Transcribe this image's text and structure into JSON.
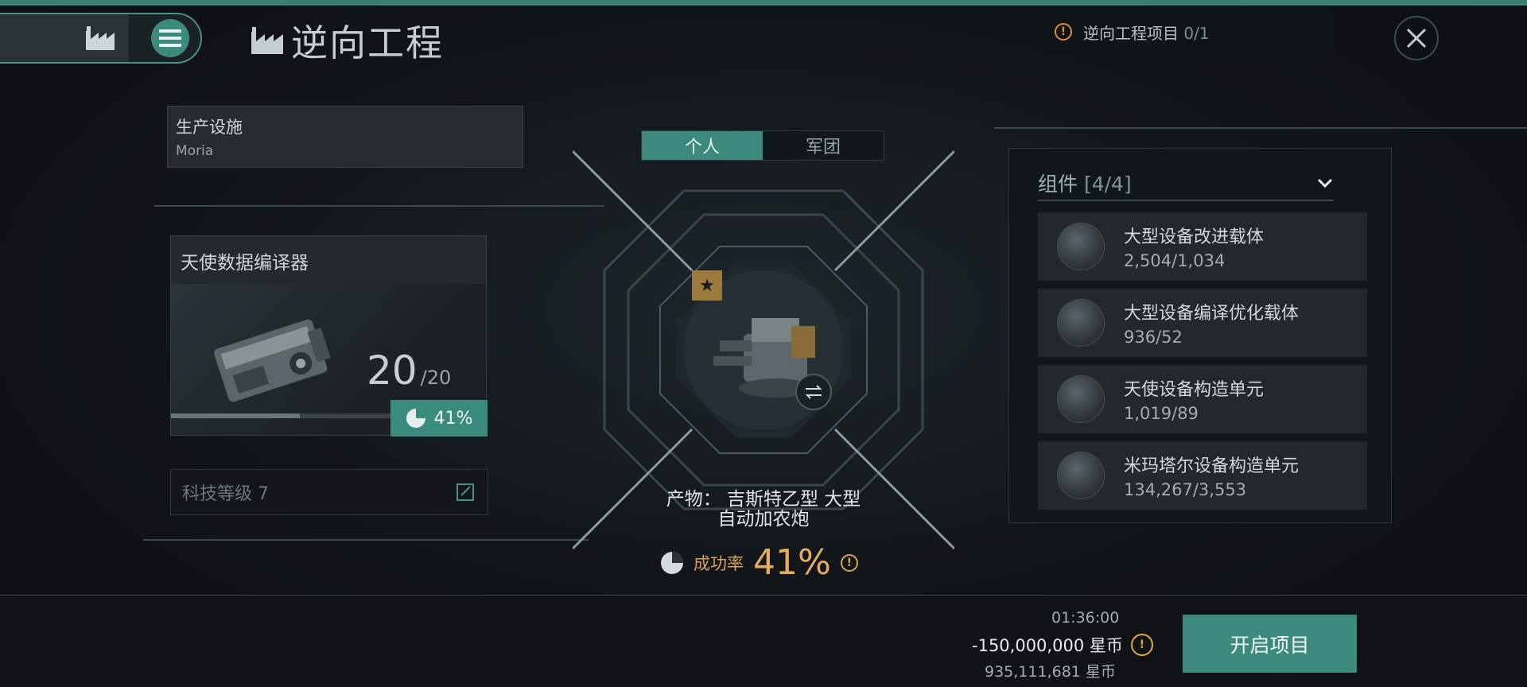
{
  "header": {
    "title": "逆向工程",
    "nav_icons": [
      "factory-icon",
      "menu-icon"
    ],
    "notice_label": "逆向工程项目",
    "notice_count": "0/1",
    "close_icon": "close-icon"
  },
  "facility": {
    "label": "生产设施",
    "value": "Moria"
  },
  "blueprint": {
    "name": "天使数据编译器",
    "runs": "20",
    "runs_max": "/20",
    "progress_fraction": 0.41,
    "percent": "41%"
  },
  "tech": {
    "label": "科技等级 7"
  },
  "tabs": [
    {
      "label": "个人",
      "active": true
    },
    {
      "label": "军团",
      "active": false
    }
  ],
  "product": {
    "line1": "产物：  吉斯特乙型 大型",
    "line2": "自动加农炮"
  },
  "success": {
    "label": "成功率",
    "value": "41%"
  },
  "components": {
    "title": "组件",
    "count": "[4/4]",
    "items": [
      {
        "name": "大型设备改进载体",
        "qty": "2,504/1,034"
      },
      {
        "name": "大型设备编译优化载体",
        "qty": "936/52"
      },
      {
        "name": "天使设备构造单元",
        "qty": "1,019/89"
      },
      {
        "name": "米玛塔尔设备构造单元",
        "qty": "134,267/3,553"
      }
    ]
  },
  "footer": {
    "duration": "01:36:00",
    "cost": "-150,000,000 星币",
    "balance": "935,111,681 星币",
    "start_label": "开启项目"
  },
  "colors": {
    "accent": "#3c8a7e",
    "gold": "#e3ad61",
    "warning": "#e08c3a"
  }
}
